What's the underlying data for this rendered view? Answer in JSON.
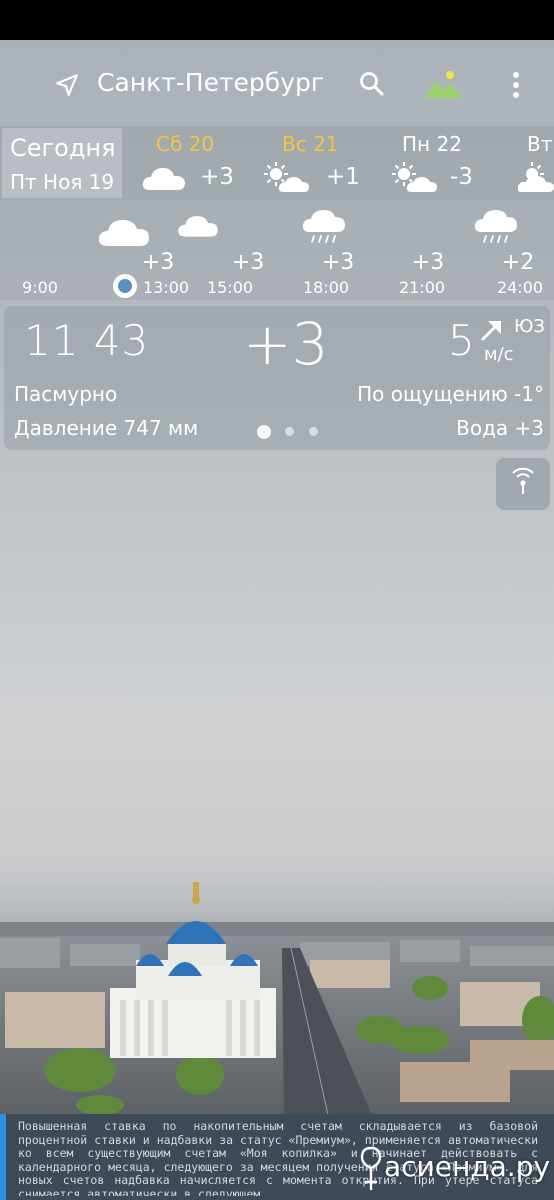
{
  "header": {
    "city": "Санкт-Петербург"
  },
  "days": {
    "today": {
      "label": "Сегодня",
      "date": "Пт Ноя 19"
    },
    "items": [
      {
        "name": "Сб 20",
        "temp": "+3",
        "icon": "cloud-icon",
        "color": "#f5c542"
      },
      {
        "name": "Вс 21",
        "temp": "+1",
        "icon": "sun-cloud-icon",
        "color": "#f5c542"
      },
      {
        "name": "Пн 22",
        "temp": "-3",
        "icon": "sun-cloud-icon",
        "color": "#ffffff"
      },
      {
        "name": "Вт",
        "temp": "",
        "icon": "sun-cloud-icon",
        "color": "#ffffff"
      }
    ]
  },
  "hourly": {
    "items": [
      {
        "time": "9:00",
        "temp": "",
        "icon": ""
      },
      {
        "time": "13:00",
        "temp": "+3",
        "icon": "cloud-icon"
      },
      {
        "time": "15:00",
        "temp": "+3",
        "icon": "cloud-icon"
      },
      {
        "time": "18:00",
        "temp": "+3",
        "icon": "rain-cloud-icon"
      },
      {
        "time": "21:00",
        "temp": "+3",
        "icon": ""
      },
      {
        "time": "24:00",
        "temp": "+2",
        "icon": "rain-cloud-icon"
      }
    ]
  },
  "current": {
    "time": "11 43",
    "temp": "+3",
    "wind_speed": "5",
    "wind_dir": "ЮЗ",
    "wind_unit": "м/с",
    "condition": "Пасмурно",
    "feels_like": "По ощущению -1°",
    "pressure": "Давление 747 мм",
    "water": "Вода +3",
    "page_index": 1,
    "page_count": 3
  },
  "ad": {
    "text": "Повышенная ставка по накопительным счетам складывается из базовой процентной ставки и надбавки за статус «Премиум», применяется автоматически ко всем существующим счетам «Моя копилка» и начинает действовать с календарного месяца, следующего за месяцем получения статуса «Премиум». Для новых счетов надбавка начисляется с момента открытия. При утере статуса снимается автоматически в следующем",
    "watermark": "асиенда.ру"
  },
  "colors": {
    "accent_yellow": "#f5c542",
    "now_dot": "#5a8fc6",
    "ad_accent": "#2f8fe0"
  }
}
